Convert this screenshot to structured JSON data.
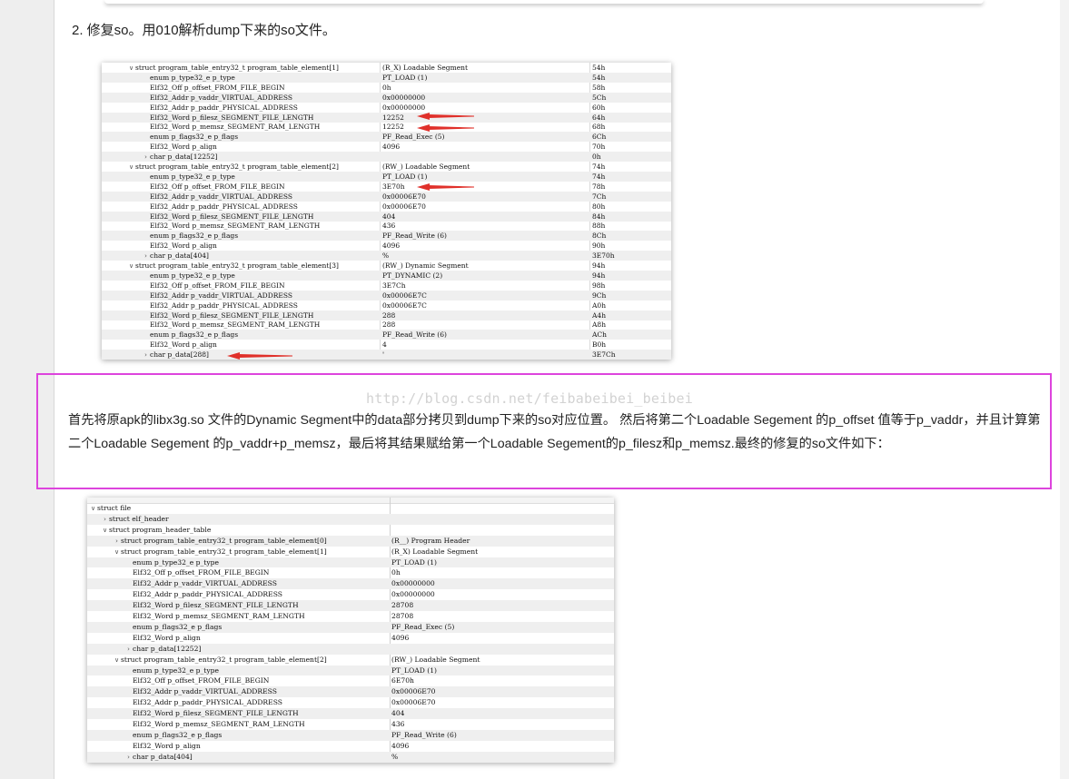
{
  "heading": "2. 修复so。用010解析dump下来的so文件。",
  "watermark": "http://blog.csdn.net/feibabeibei_beibei",
  "paragraph": "首先将原apk的libx3g.so 文件的Dynamic Segment中的data部分拷贝到dump下来的so对应位置。 然后将第二个Loadable Segement 的p_offset 值等于p_vaddr，并且计算第二个Loadable Segement 的p_vaddr+p_memsz，最后将其结果赋给第一个Loadable Segement的p_filesz和p_memsz.最终的修复的so文件如下：",
  "template1": {
    "rows": [
      {
        "indent": 0,
        "twisty": "v",
        "name": "struct program_table_entry32_t program_table_element[1]",
        "value": "(R_X) Loadable Segment",
        "start": "54h"
      },
      {
        "indent": 1,
        "twisty": "",
        "name": "enum p_type32_e p_type",
        "value": "PT_LOAD (1)",
        "start": "54h"
      },
      {
        "indent": 1,
        "twisty": "",
        "name": "Elf32_Off p_offset_FROM_FILE_BEGIN",
        "value": "0h",
        "start": "58h"
      },
      {
        "indent": 1,
        "twisty": "",
        "name": "Elf32_Addr p_vaddr_VIRTUAL_ADDRESS",
        "value": "0x00000000",
        "start": "5Ch"
      },
      {
        "indent": 1,
        "twisty": "",
        "name": "Elf32_Addr p_paddr_PHYSICAL_ADDRESS",
        "value": "0x00000000",
        "start": "60h"
      },
      {
        "indent": 1,
        "twisty": "",
        "name": "Elf32_Word p_filesz_SEGMENT_FILE_LENGTH",
        "value": "12252",
        "start": "64h"
      },
      {
        "indent": 1,
        "twisty": "",
        "name": "Elf32_Word p_memsz_SEGMENT_RAM_LENGTH",
        "value": "12252",
        "start": "68h"
      },
      {
        "indent": 1,
        "twisty": "",
        "name": "enum p_flags32_e p_flags",
        "value": "PF_Read_Exec (5)",
        "start": "6Ch"
      },
      {
        "indent": 1,
        "twisty": "",
        "name": "Elf32_Word p_align",
        "value": "4096",
        "start": "70h"
      },
      {
        "indent": 1,
        "twisty": ">",
        "name": "char p_data[12252]",
        "value": "",
        "start": "0h"
      },
      {
        "indent": 0,
        "twisty": "v",
        "name": "struct program_table_entry32_t program_table_element[2]",
        "value": "(RW_) Loadable Segment",
        "start": "74h"
      },
      {
        "indent": 1,
        "twisty": "",
        "name": "enum p_type32_e p_type",
        "value": "PT_LOAD (1)",
        "start": "74h"
      },
      {
        "indent": 1,
        "twisty": "",
        "name": "Elf32_Off p_offset_FROM_FILE_BEGIN",
        "value": "3E70h",
        "start": "78h"
      },
      {
        "indent": 1,
        "twisty": "",
        "name": "Elf32_Addr p_vaddr_VIRTUAL_ADDRESS",
        "value": "0x00006E70",
        "start": "7Ch"
      },
      {
        "indent": 1,
        "twisty": "",
        "name": "Elf32_Addr p_paddr_PHYSICAL_ADDRESS",
        "value": "0x00006E70",
        "start": "80h"
      },
      {
        "indent": 1,
        "twisty": "",
        "name": "Elf32_Word p_filesz_SEGMENT_FILE_LENGTH",
        "value": "404",
        "start": "84h"
      },
      {
        "indent": 1,
        "twisty": "",
        "name": "Elf32_Word p_memsz_SEGMENT_RAM_LENGTH",
        "value": "436",
        "start": "88h"
      },
      {
        "indent": 1,
        "twisty": "",
        "name": "enum p_flags32_e p_flags",
        "value": "PF_Read_Write (6)",
        "start": "8Ch"
      },
      {
        "indent": 1,
        "twisty": "",
        "name": "Elf32_Word p_align",
        "value": "4096",
        "start": "90h"
      },
      {
        "indent": 1,
        "twisty": ">",
        "name": "char p_data[404]",
        "value": "%",
        "start": "3E70h"
      },
      {
        "indent": 0,
        "twisty": "v",
        "name": "struct program_table_entry32_t program_table_element[3]",
        "value": "(RW_) Dynamic Segment",
        "start": "94h"
      },
      {
        "indent": 1,
        "twisty": "",
        "name": "enum p_type32_e p_type",
        "value": "PT_DYNAMIC (2)",
        "start": "94h"
      },
      {
        "indent": 1,
        "twisty": "",
        "name": "Elf32_Off p_offset_FROM_FILE_BEGIN",
        "value": "3E7Ch",
        "start": "98h"
      },
      {
        "indent": 1,
        "twisty": "",
        "name": "Elf32_Addr p_vaddr_VIRTUAL_ADDRESS",
        "value": "0x00006E7C",
        "start": "9Ch"
      },
      {
        "indent": 1,
        "twisty": "",
        "name": "Elf32_Addr p_paddr_PHYSICAL_ADDRESS",
        "value": "0x00006E7C",
        "start": "A0h"
      },
      {
        "indent": 1,
        "twisty": "",
        "name": "Elf32_Word p_filesz_SEGMENT_FILE_LENGTH",
        "value": "288",
        "start": "A4h"
      },
      {
        "indent": 1,
        "twisty": "",
        "name": "Elf32_Word p_memsz_SEGMENT_RAM_LENGTH",
        "value": "288",
        "start": "A8h"
      },
      {
        "indent": 1,
        "twisty": "",
        "name": "enum p_flags32_e p_flags",
        "value": "PF_Read_Write (6)",
        "start": "ACh"
      },
      {
        "indent": 1,
        "twisty": "",
        "name": "Elf32_Word p_align",
        "value": "4",
        "start": "B0h"
      },
      {
        "indent": 1,
        "twisty": ">",
        "name": "char p_data[288]",
        "value": "'",
        "start": "3E7Ch"
      }
    ]
  },
  "template2": {
    "rows": [
      {
        "indent": 0,
        "twisty": "v",
        "name": "struct file",
        "value": ""
      },
      {
        "indent": 1,
        "twisty": ">",
        "name": "struct elf_header",
        "value": ""
      },
      {
        "indent": 1,
        "twisty": "v",
        "name": "struct program_header_table",
        "value": ""
      },
      {
        "indent": 2,
        "twisty": ">",
        "name": "struct program_table_entry32_t program_table_element[0]",
        "value": "(R__) Program Header"
      },
      {
        "indent": 2,
        "twisty": "v",
        "name": "struct program_table_entry32_t program_table_element[1]",
        "value": "(R_X) Loadable Segment"
      },
      {
        "indent": 3,
        "twisty": "",
        "name": "enum p_type32_e p_type",
        "value": "PT_LOAD (1)"
      },
      {
        "indent": 3,
        "twisty": "",
        "name": "Elf32_Off p_offset_FROM_FILE_BEGIN",
        "value": "0h"
      },
      {
        "indent": 3,
        "twisty": "",
        "name": "Elf32_Addr p_vaddr_VIRTUAL_ADDRESS",
        "value": "0x00000000"
      },
      {
        "indent": 3,
        "twisty": "",
        "name": "Elf32_Addr p_paddr_PHYSICAL_ADDRESS",
        "value": "0x00000000"
      },
      {
        "indent": 3,
        "twisty": "",
        "name": "Elf32_Word p_filesz_SEGMENT_FILE_LENGTH",
        "value": "28708"
      },
      {
        "indent": 3,
        "twisty": "",
        "name": "Elf32_Word p_memsz_SEGMENT_RAM_LENGTH",
        "value": "28708"
      },
      {
        "indent": 3,
        "twisty": "",
        "name": "enum p_flags32_e p_flags",
        "value": "PF_Read_Exec (5)"
      },
      {
        "indent": 3,
        "twisty": "",
        "name": "Elf32_Word p_align",
        "value": "4096"
      },
      {
        "indent": 3,
        "twisty": ">",
        "name": "char p_data[12252]",
        "value": ""
      },
      {
        "indent": 2,
        "twisty": "v",
        "name": "struct program_table_entry32_t program_table_element[2]",
        "value": "(RW_) Loadable Segment"
      },
      {
        "indent": 3,
        "twisty": "",
        "name": "enum p_type32_e p_type",
        "value": "PT_LOAD (1)"
      },
      {
        "indent": 3,
        "twisty": "",
        "name": "Elf32_Off p_offset_FROM_FILE_BEGIN",
        "value": "6E70h"
      },
      {
        "indent": 3,
        "twisty": "",
        "name": "Elf32_Addr p_vaddr_VIRTUAL_ADDRESS",
        "value": "0x00006E70"
      },
      {
        "indent": 3,
        "twisty": "",
        "name": "Elf32_Addr p_paddr_PHYSICAL_ADDRESS",
        "value": "0x00006E70"
      },
      {
        "indent": 3,
        "twisty": "",
        "name": "Elf32_Word p_filesz_SEGMENT_FILE_LENGTH",
        "value": "404"
      },
      {
        "indent": 3,
        "twisty": "",
        "name": "Elf32_Word p_memsz_SEGMENT_RAM_LENGTH",
        "value": "436"
      },
      {
        "indent": 3,
        "twisty": "",
        "name": "enum p_flags32_e p_flags",
        "value": "PF_Read_Write (6)"
      },
      {
        "indent": 3,
        "twisty": "",
        "name": "Elf32_Word p_align",
        "value": "4096"
      },
      {
        "indent": 3,
        "twisty": ">",
        "name": "char p_data[404]",
        "value": "%"
      }
    ]
  },
  "colors": {
    "callout_border": "#dd44dd",
    "arrow": "#e0302a",
    "watermark": "#d2d2d2"
  }
}
